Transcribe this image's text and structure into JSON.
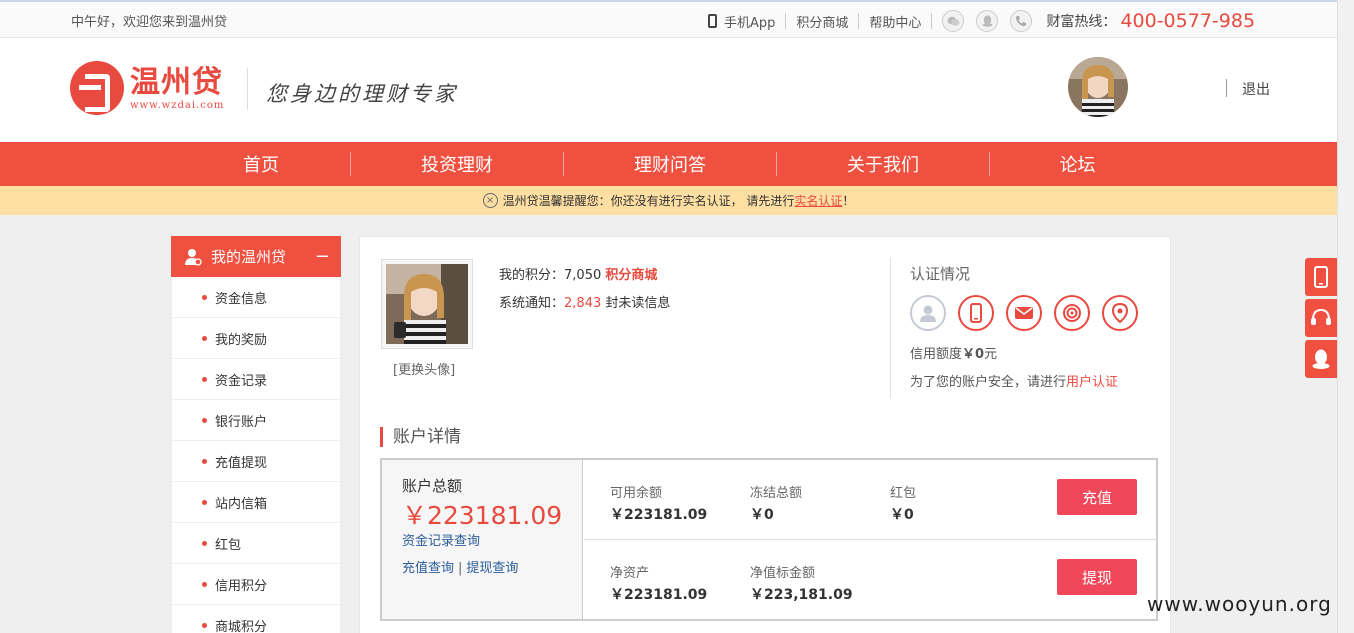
{
  "topbar": {
    "greeting": "中午好，欢迎您来到温州贷",
    "mobile_app": "手机App",
    "points_mall": "积分商城",
    "help_center": "帮助中心",
    "hotline_label": "财富热线：",
    "hotline_number": "400-0577-985",
    "social_icons": [
      "wechat-icon",
      "qq-icon",
      "phone-call-icon"
    ]
  },
  "header": {
    "logo_cn": "温州贷",
    "logo_url": "www.wzdai.com",
    "slogan": "您身边的理财专家",
    "logout": "退出"
  },
  "nav": {
    "items": [
      "首页",
      "投资理财",
      "理财问答",
      "关于我们",
      "论坛"
    ]
  },
  "notice": {
    "text": "温州贷温馨提醒您：你还没有进行实名认证，  请先进行",
    "link": "实名认证",
    "suffix": "！"
  },
  "sidebar": {
    "title": "我的温州贷",
    "collapse": "−",
    "items": [
      "资金信息",
      "我的奖励",
      "资金记录",
      "银行账户",
      "充值提现",
      "站内信箱",
      "红包",
      "信用积分",
      "商城积分"
    ]
  },
  "profile": {
    "change_avatar": "[更换头像]",
    "score_label": "我的积分：",
    "score_value": "7,050",
    "score_mall": "积分商城",
    "notify_label": "系统通知：",
    "notify_count": "2,843",
    "notify_suffix": "封未读信息"
  },
  "auth": {
    "title": "认证情况",
    "icons": [
      "user-icon",
      "mobile-icon",
      "email-icon",
      "target-icon",
      "location-icon"
    ],
    "credit_label": "信用额度",
    "credit_value": "￥0",
    "credit_unit": "元",
    "security_text": "为了您的账户安全，请进行",
    "security_link": "用户认证"
  },
  "account": {
    "section_title": "账户详情",
    "total_label": "账户总额",
    "total_value": "￥223181.09",
    "record_query": "资金记录查询",
    "recharge_query": "充值查询",
    "query_sep": "|",
    "withdraw_query": "提现查询",
    "available_label": "可用余额",
    "available_value": "￥223181.09",
    "frozen_label": "冻结总额",
    "frozen_value": "￥0",
    "redpacket_label": "红包",
    "redpacket_value": "￥0",
    "recharge_button": "充值",
    "net_assets_label": "净资产",
    "net_assets_value": "￥223181.09",
    "net_bid_label": "净值标金额",
    "net_bid_value": "￥223,181.09",
    "withdraw_button": "提现"
  },
  "float_bar": [
    "mobile-icon",
    "headset-icon",
    "qq-icon"
  ],
  "watermark": "www.wooyun.org",
  "colors": {
    "brand_red": "#f0503f",
    "notice_bg": "#fddfa3",
    "button_red": "#f0485a",
    "link_blue": "#2a5d9a"
  }
}
